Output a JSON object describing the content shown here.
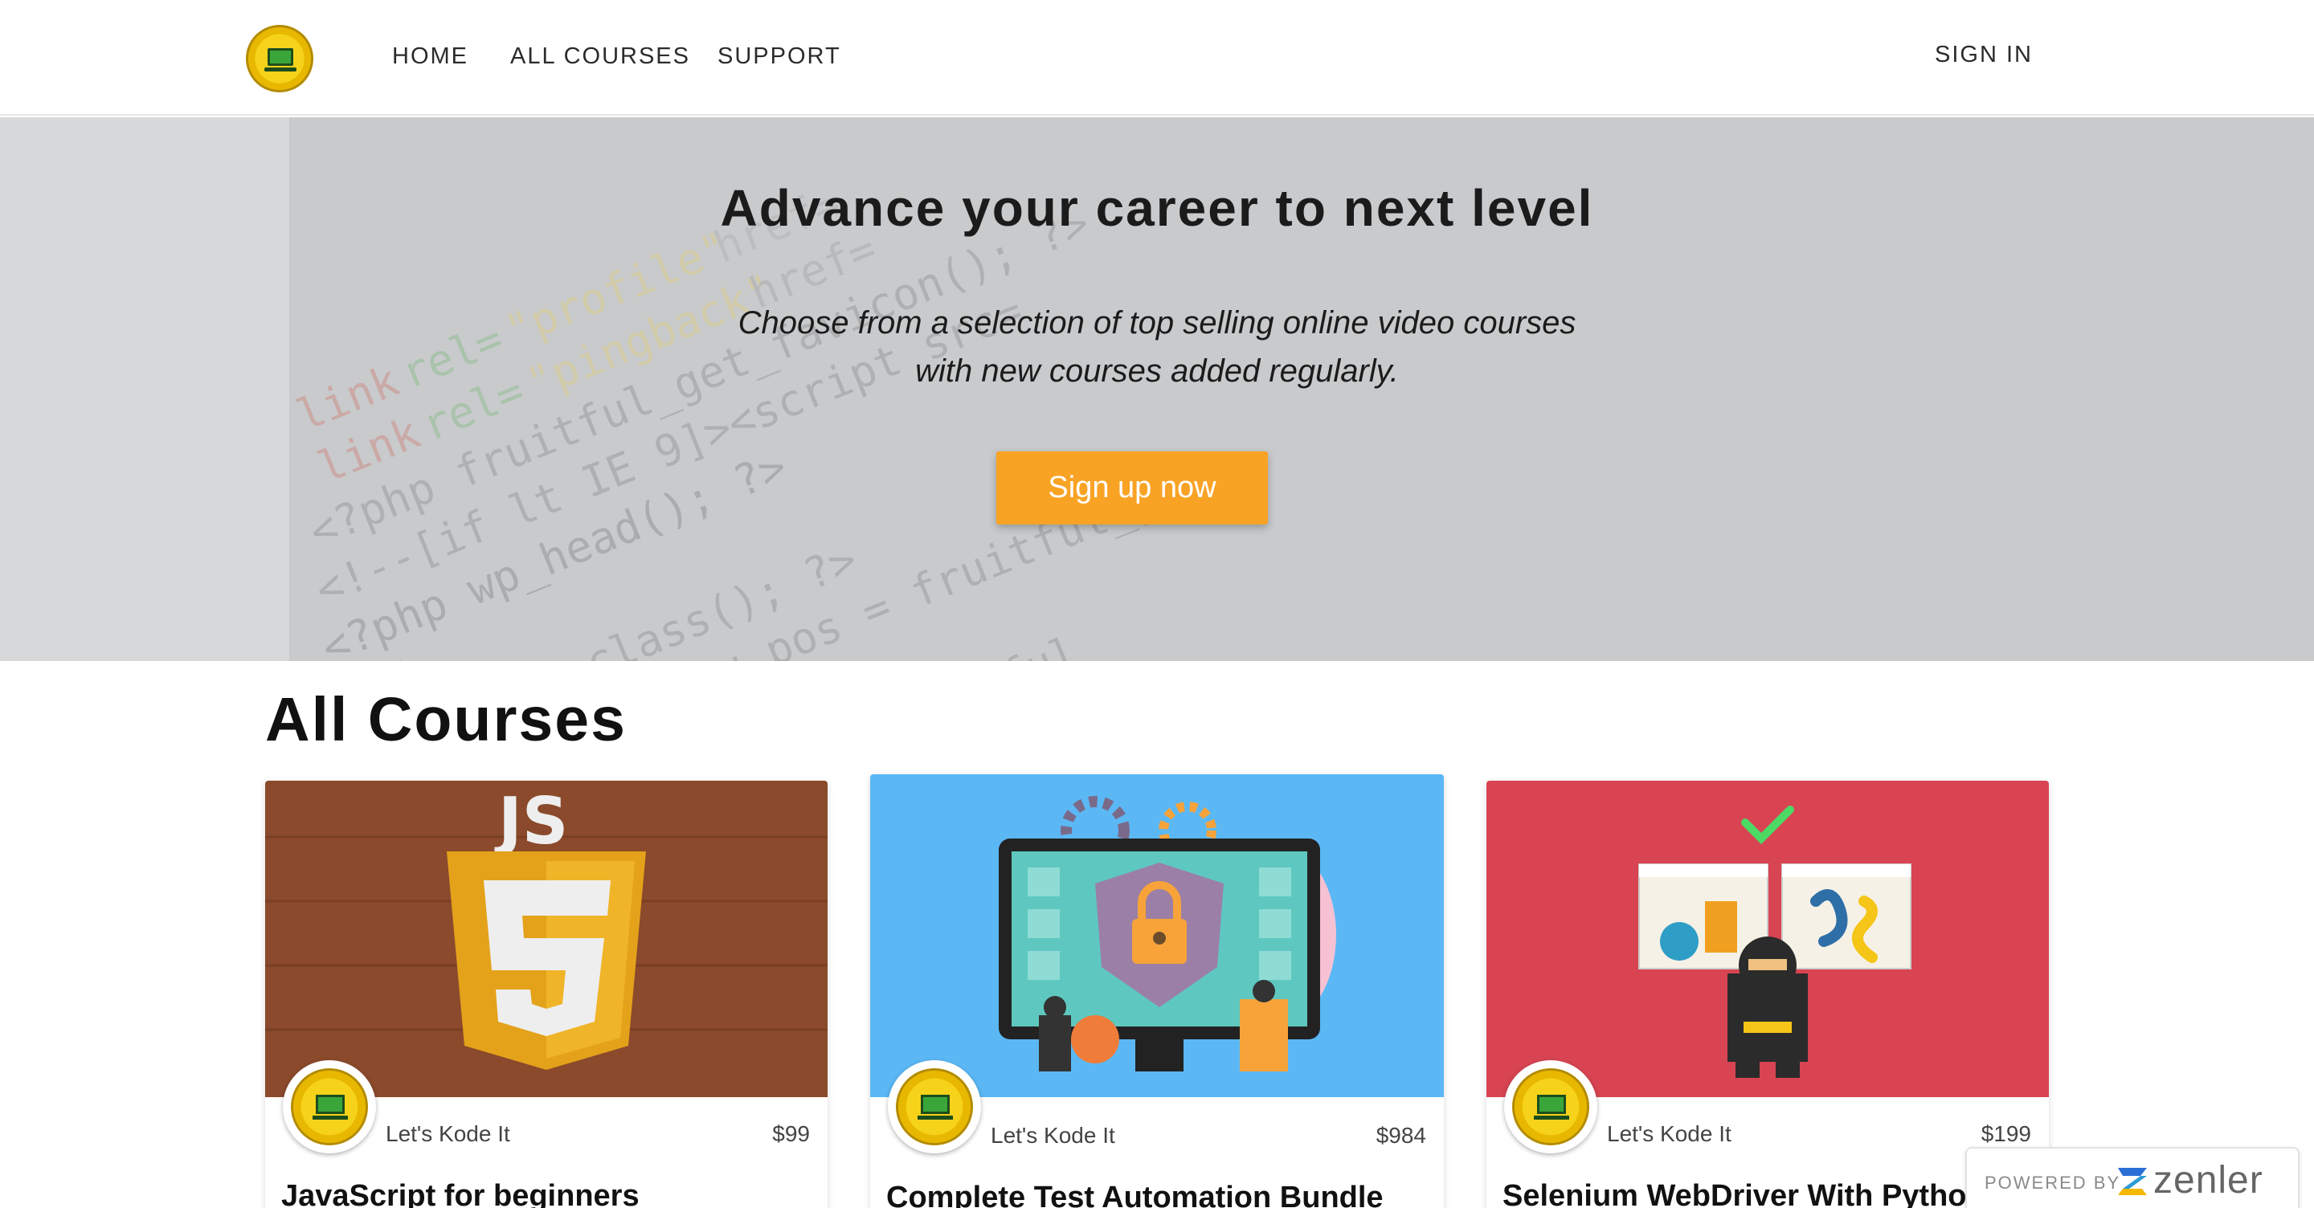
{
  "nav": {
    "home": "HOME",
    "all_courses": "ALL COURSES",
    "support": "SUPPORT",
    "sign_in": "SIGN IN"
  },
  "hero": {
    "title": "Advance your career to next level",
    "subtitle_line1": "Choose from a selection of top selling online video courses",
    "subtitle_line2": "with new courses added regularly.",
    "cta": "Sign up now"
  },
  "courses": {
    "heading": "All Courses",
    "items": [
      {
        "author": "Let's Kode It",
        "price": "$99",
        "title": "JavaScript for beginners"
      },
      {
        "author": "Let's Kode It",
        "price": "$984",
        "title": "Complete Test Automation Bundle"
      },
      {
        "author": "Let's Kode It",
        "price": "$199",
        "title": "Selenium WebDriver With Python"
      }
    ]
  },
  "powered_by": {
    "label": "POWERED BY",
    "brand": "zenler"
  },
  "colors": {
    "cta": "#f9a325",
    "js_wood": "#8b4a2b",
    "js_shield": "#e3a21a",
    "automation_bg": "#5bb8f5",
    "selenium_bg": "#d84452"
  }
}
